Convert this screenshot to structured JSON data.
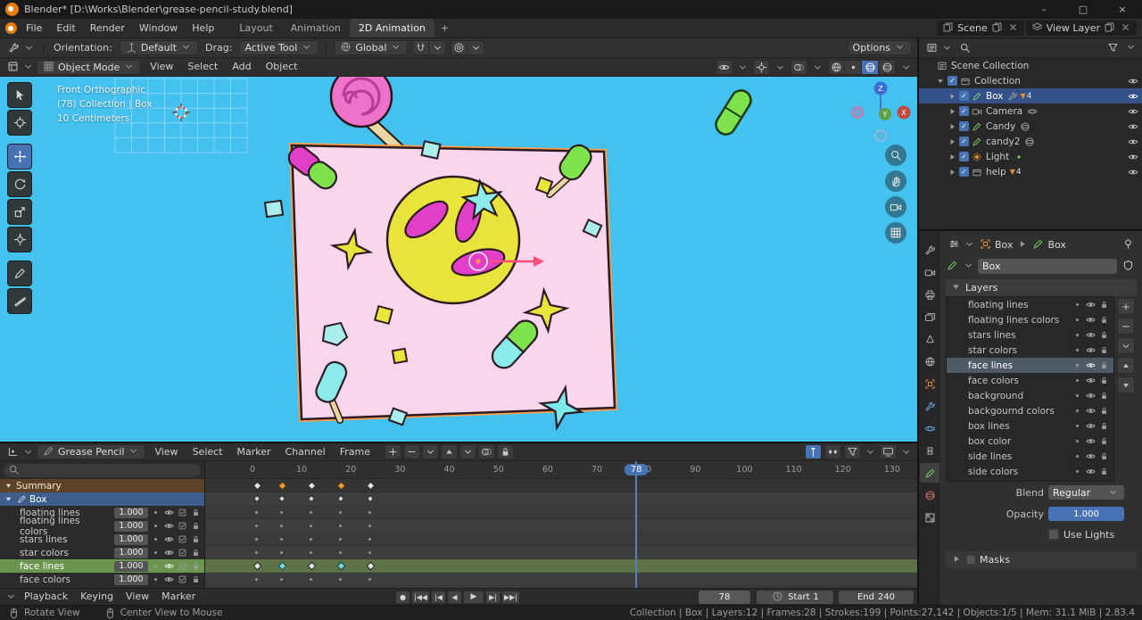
{
  "colors": {
    "accent_blue": "#4772b3",
    "viewport_sky": "#43c2f0",
    "selection_orange": "#ff9e4a",
    "summary_row": "#5e4226",
    "object_row_blue": "#3e5f8d",
    "selected_channel_green": "#6c9550"
  },
  "titlebar": {
    "title": "Blender* [D:\\Works\\Blender\\grease-pencil-study.blend]",
    "window_controls": {
      "minimize": "–",
      "maximize": "□",
      "close": "×"
    }
  },
  "topbar": {
    "menus": [
      "File",
      "Edit",
      "Render",
      "Window",
      "Help"
    ],
    "workspaces": [
      {
        "label": "Layout",
        "active": false
      },
      {
        "label": "Animation",
        "active": false
      },
      {
        "label": "2D Animation",
        "active": true
      }
    ],
    "add_workspace_label": "+",
    "scene_value": "Scene",
    "view_layer_value": "View Layer"
  },
  "tool_settings": {
    "orientation_label": "Orientation:",
    "orientation_value": "Default",
    "drag_label": "Drag:",
    "drag_value": "Active Tool",
    "transform_pivot_value": "Global",
    "options_label": "Options"
  },
  "viewport": {
    "mode_value": "Object Mode",
    "menus": [
      "View",
      "Select",
      "Add",
      "Object"
    ],
    "overlay_lines": [
      "Front Orthographic",
      "(78) Collection | Box",
      "10 Centimeters"
    ],
    "gizmo_axis_labels": {
      "x": "X",
      "y": "Y",
      "z": "Z"
    },
    "toolbar_tools": [
      "select-box-tool",
      "cursor-tool",
      "move-tool",
      "rotate-tool",
      "scale-tool",
      "transform-tool",
      "annotate-tool",
      "measure-tool"
    ],
    "active_tool": "move-tool"
  },
  "outliner": {
    "rows": [
      {
        "label": "Scene Collection",
        "icon": "scenecoll",
        "indent": 0,
        "expand": "none",
        "checkbox": false,
        "eye": false
      },
      {
        "label": "Collection",
        "icon": "collection",
        "indent": 1,
        "expand": "down",
        "checkbox": true,
        "eye": true
      },
      {
        "label": "Box",
        "icon": "gpencil",
        "indent": 2,
        "expand": "right",
        "checkbox": true,
        "selected": true,
        "extra": "modifier",
        "count": "4",
        "eye": true
      },
      {
        "label": "Camera",
        "icon": "camera",
        "indent": 2,
        "expand": "right",
        "checkbox": true,
        "extra": "constraint",
        "eye": true
      },
      {
        "label": "Candy",
        "icon": "gpencil",
        "indent": 2,
        "expand": "right",
        "checkbox": true,
        "extra": "material",
        "eye": true
      },
      {
        "label": "candy2",
        "icon": "gpencil",
        "indent": 2,
        "expand": "right",
        "checkbox": true,
        "extra": "material",
        "eye": true
      },
      {
        "label": "Light",
        "icon": "light",
        "indent": 2,
        "expand": "right",
        "checkbox": true,
        "extra": "data",
        "eye": true
      },
      {
        "label": "help",
        "icon": "collection",
        "indent": 2,
        "expand": "right",
        "checkbox": true,
        "count": "4",
        "eye": true
      }
    ]
  },
  "properties": {
    "tabs": [
      "tool",
      "render",
      "output",
      "view-layer",
      "scene",
      "world",
      "object",
      "modifiers",
      "physics",
      "constraints",
      "object-data",
      "material",
      "texture"
    ],
    "active_tab": "object-data",
    "breadcrumb": {
      "object_label": "Box",
      "data_label": "Box"
    },
    "datablock_value": "Box",
    "layers_panel_label": "Layers",
    "layers": [
      {
        "name": "floating lines",
        "selected": false
      },
      {
        "name": "floating lines colors",
        "selected": false
      },
      {
        "name": "stars lines",
        "selected": false
      },
      {
        "name": "star colors",
        "selected": false
      },
      {
        "name": "face lines",
        "selected": true
      },
      {
        "name": "face colors",
        "selected": false
      },
      {
        "name": "background",
        "selected": false
      },
      {
        "name": "backgournd colors",
        "selected": false
      },
      {
        "name": "box lines",
        "selected": false
      },
      {
        "name": "box color",
        "selected": false
      },
      {
        "name": "side lines",
        "selected": false
      },
      {
        "name": "side colors",
        "selected": false
      }
    ],
    "blend_label": "Blend",
    "blend_value": "Regular",
    "opacity_label": "Opacity",
    "opacity_value": "1.000",
    "use_lights_label": "Use Lights",
    "masks_label": "Masks"
  },
  "dopesheet": {
    "editor_mode_value": "Grease Pencil",
    "menus": [
      "View",
      "Select",
      "Marker",
      "Channel",
      "Frame"
    ],
    "ruler_labels": [
      0,
      10,
      20,
      30,
      40,
      50,
      60,
      70,
      80,
      90,
      100,
      110,
      120,
      130
    ],
    "current_frame": 78,
    "channels": [
      {
        "name": "Summary",
        "kind": "summary",
        "keys": [
          {
            "f": 1,
            "c": "white"
          },
          {
            "f": 6,
            "c": "orange"
          },
          {
            "f": 12,
            "c": "white"
          },
          {
            "f": 18,
            "c": "orange"
          },
          {
            "f": 24,
            "c": "white"
          }
        ]
      },
      {
        "name": "Box",
        "kind": "object",
        "keys": [
          {
            "f": 1,
            "c": "boxk"
          },
          {
            "f": 6,
            "c": "boxk"
          },
          {
            "f": 12,
            "c": "boxk"
          },
          {
            "f": 18,
            "c": "boxk"
          },
          {
            "f": 24,
            "c": "boxk"
          }
        ]
      },
      {
        "name": "floating lines",
        "kind": "layer",
        "value": "1.000",
        "keys": [
          {
            "f": 1,
            "c": "gray"
          },
          {
            "f": 6,
            "c": "gray"
          },
          {
            "f": 12,
            "c": "gray"
          },
          {
            "f": 18,
            "c": "gray"
          },
          {
            "f": 24,
            "c": "gray"
          }
        ]
      },
      {
        "name": "floating lines colors",
        "kind": "layer",
        "value": "1.000",
        "keys": [
          {
            "f": 1,
            "c": "gray"
          },
          {
            "f": 6,
            "c": "gray"
          },
          {
            "f": 12,
            "c": "gray"
          },
          {
            "f": 18,
            "c": "gray"
          },
          {
            "f": 24,
            "c": "gray"
          }
        ]
      },
      {
        "name": "stars lines",
        "kind": "layer",
        "value": "1.000",
        "keys": [
          {
            "f": 1,
            "c": "gray"
          },
          {
            "f": 6,
            "c": "gray"
          },
          {
            "f": 12,
            "c": "gray"
          },
          {
            "f": 18,
            "c": "gray"
          },
          {
            "f": 24,
            "c": "gray"
          }
        ]
      },
      {
        "name": "star colors",
        "kind": "layer",
        "value": "1.000",
        "keys": [
          {
            "f": 1,
            "c": "gray"
          },
          {
            "f": 6,
            "c": "gray"
          },
          {
            "f": 12,
            "c": "gray"
          },
          {
            "f": 18,
            "c": "gray"
          },
          {
            "f": 24,
            "c": "gray"
          }
        ]
      },
      {
        "name": "face lines",
        "kind": "layer",
        "value": "1.000",
        "selected": true,
        "keys": [
          {
            "f": 1,
            "c": "white"
          },
          {
            "f": 6,
            "c": "teal"
          },
          {
            "f": 12,
            "c": "white"
          },
          {
            "f": 18,
            "c": "teal"
          },
          {
            "f": 24,
            "c": "white"
          }
        ]
      },
      {
        "name": "face colors",
        "kind": "layer",
        "value": "1.000",
        "keys": [
          {
            "f": 1,
            "c": "gray"
          },
          {
            "f": 6,
            "c": "gray"
          },
          {
            "f": 12,
            "c": "gray"
          },
          {
            "f": 18,
            "c": "gray"
          },
          {
            "f": 24,
            "c": "gray"
          }
        ]
      }
    ]
  },
  "playback": {
    "menus": [
      "Playback",
      "Keying",
      "View",
      "Marker"
    ],
    "transport": [
      {
        "name": "auto-keying",
        "glyph": "●"
      },
      {
        "name": "jump-to-start",
        "glyph": "|◀◀"
      },
      {
        "name": "previous-keyframe",
        "glyph": "|◀"
      },
      {
        "name": "play-reverse",
        "glyph": "◀"
      },
      {
        "name": "play",
        "glyph": "▶",
        "big": true
      },
      {
        "name": "next-keyframe",
        "glyph": "▶|"
      },
      {
        "name": "jump-to-end",
        "glyph": "▶▶|"
      }
    ],
    "current_frame": "78",
    "start_label": "Start",
    "start_value": "1",
    "end_label": "End",
    "end_value": "240"
  },
  "statusbar": {
    "hints": [
      {
        "label": "Rotate View"
      },
      {
        "label": "Center View to Mouse"
      }
    ],
    "stats": "Collection | Box | Layers:12 | Frames:28 | Strokes:199 | Points:27,142 | Objects:1/5 | Mem: 31.1 MiB | 2.83.4"
  }
}
